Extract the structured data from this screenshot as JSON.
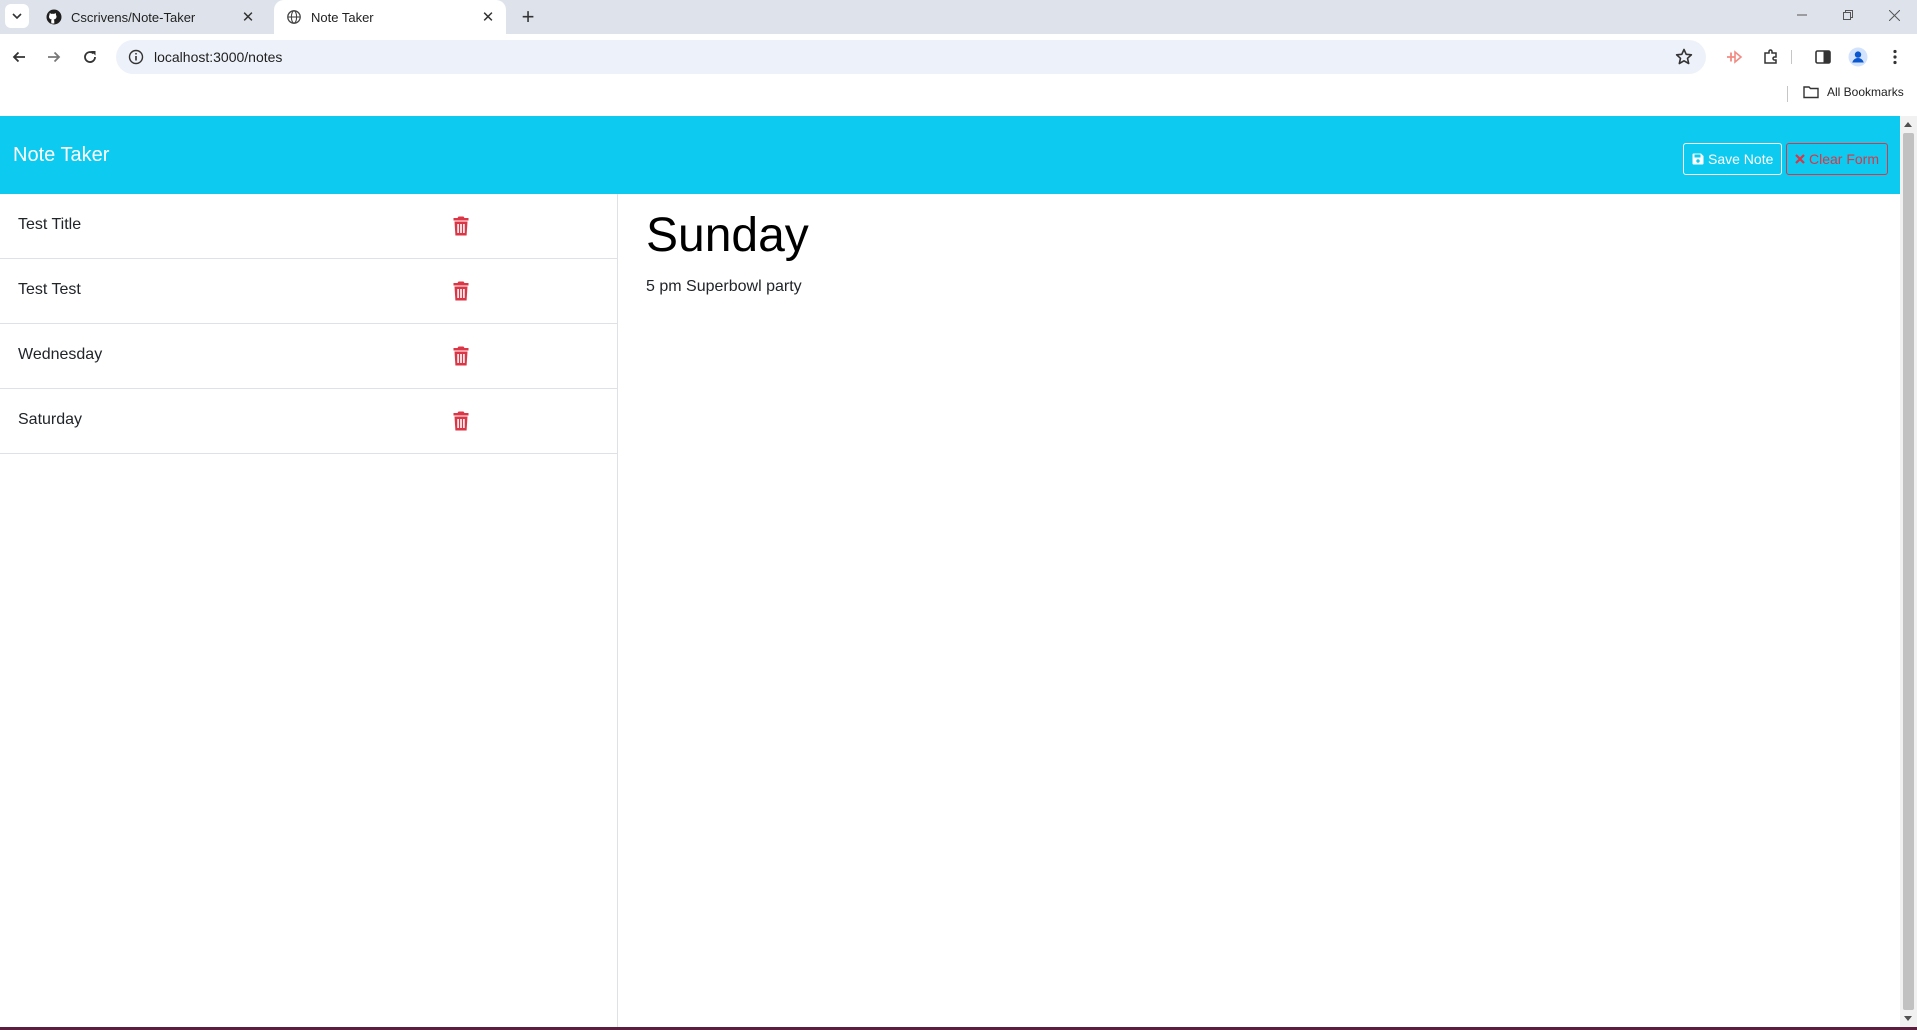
{
  "browser": {
    "tabs": [
      {
        "title": "Cscrivens/Note-Taker",
        "icon": "github-icon",
        "active": false
      },
      {
        "title": "Note Taker",
        "icon": "globe-icon",
        "active": true
      }
    ],
    "url": "localhost:3000/notes",
    "bookmarks_label": "All Bookmarks"
  },
  "app": {
    "brand": "Note Taker",
    "save_label": "Save Note",
    "clear_label": "Clear Form",
    "colors": {
      "navbar": "#0dcaf0",
      "danger": "#dc3545"
    }
  },
  "notes": [
    {
      "title": "Test Title"
    },
    {
      "title": "Test Test"
    },
    {
      "title": "Wednesday"
    },
    {
      "title": "Saturday"
    }
  ],
  "active_note": {
    "title": "Sunday",
    "text": "5 pm Superbowl party"
  }
}
